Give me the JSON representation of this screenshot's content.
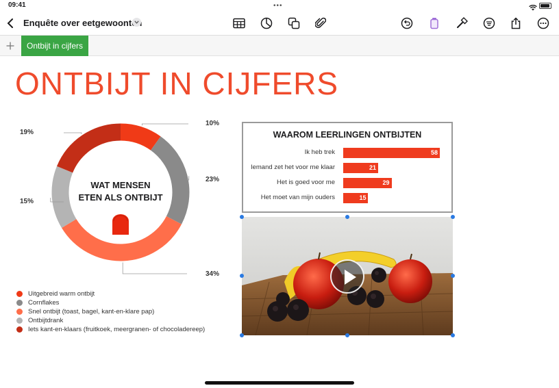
{
  "status_bar": {
    "time": "09:41",
    "dots": "•••"
  },
  "toolbar": {
    "title": "Enquête over eetgewoonten"
  },
  "tabs": {
    "add_label": "+",
    "active": "Ontbijt in cijfers"
  },
  "page": {
    "heading": "ONTBIJT IN CIJFERS"
  },
  "donut": {
    "title_line1": "WAT MENSEN",
    "title_line2": "ETEN ALS ONTBIJT",
    "percent_labels": [
      "10%",
      "23%",
      "34%",
      "15%",
      "19%"
    ]
  },
  "legend": [
    {
      "label": "Uitgebreid warm ontbijt",
      "color": "#f03a17"
    },
    {
      "label": "Cornflakes",
      "color": "#8a8a8a"
    },
    {
      "label": "Snel ontbijt (toast, bagel, kant-en-klare pap)",
      "color": "#ff6e4a"
    },
    {
      "label": "Ontbijtdrank",
      "color": "#b4b4b4"
    },
    {
      "label": "Iets kant-en-klaars (fruitkoek, meergranen- of chocoladereep)",
      "color": "#c32e17"
    }
  ],
  "chart_data": [
    {
      "type": "pie",
      "title": "WAT MENSEN ETEN ALS ONTBIJT",
      "categories": [
        "Uitgebreid warm ontbijt",
        "Cornflakes",
        "Snel ontbijt (toast, bagel, kant-en-klare pap)",
        "Ontbijtdrank",
        "Iets kant-en-klaars (fruitkoek, meergranen- of chocoladereep)"
      ],
      "values": [
        10,
        23,
        34,
        15,
        19
      ],
      "colors": [
        "#f03a17",
        "#8a8a8a",
        "#ff6e4a",
        "#b4b4b4",
        "#c32e17"
      ],
      "legend": "bottom-left"
    },
    {
      "type": "bar",
      "title": "WAAROM LEERLINGEN ONTBIJTEN",
      "categories": [
        "Ik heb trek",
        "Iemand zet het voor me klaar",
        "Het is goed voor me",
        "Het moet van mijn ouders"
      ],
      "values": [
        58,
        21,
        29,
        15
      ],
      "color": "#ef3b1e",
      "orientation": "horizontal",
      "xlim": [
        0,
        58
      ]
    }
  ]
}
